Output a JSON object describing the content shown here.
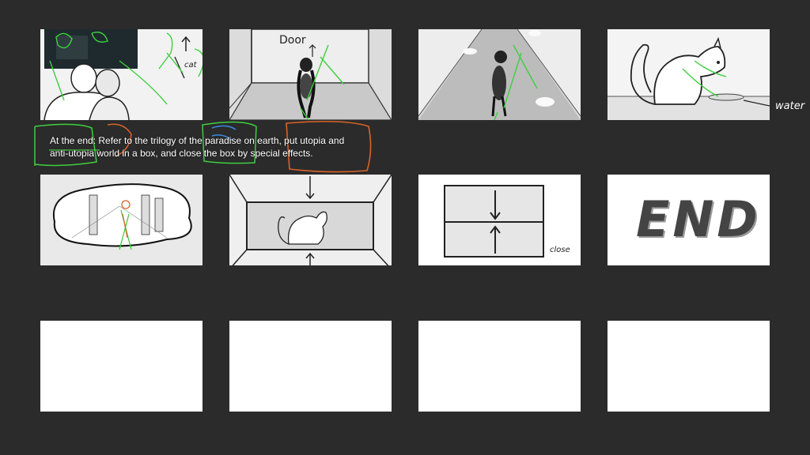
{
  "storyboard": {
    "note_text_line1": "At the end: Refer to the trilogy of the paradise on earth, put utopia and",
    "note_text_line2": "anti-utopia  world in a box, and close the box by special effects.",
    "frame1": {
      "label": "cat"
    },
    "frame2": {
      "label": "Door"
    },
    "frame4": {
      "label": "water"
    },
    "frame7": {
      "label": "close"
    },
    "frame8": {
      "label": "END"
    }
  },
  "colors": {
    "background": "#2b2b2b",
    "frame": "#ffffff",
    "annotation_green": "#3ecf3e",
    "annotation_orange": "#d9642a",
    "annotation_blue": "#3a8ae0"
  }
}
